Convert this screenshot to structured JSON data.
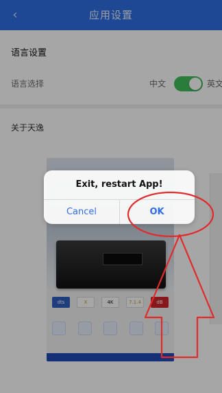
{
  "header": {
    "title": "应用设置",
    "back_icon": "chevron-left-icon"
  },
  "language_section": {
    "title": "语言设置",
    "row_label": "语言选择",
    "option_left": "中文",
    "option_right": "英文",
    "toggle_on": true
  },
  "about_section": {
    "label": "关于天逸"
  },
  "product_card": {
    "logos": [
      "dts",
      "X",
      "4K",
      "7.1.4",
      "dB"
    ],
    "bottom_badge": ""
  },
  "dialog": {
    "message": "Exit, restart App!",
    "cancel_label": "Cancel",
    "ok_label": "OK"
  },
  "colors": {
    "header_blue": "#2f6fe3",
    "toggle_green": "#3fbf5a",
    "annotation_red": "#e12a2a"
  }
}
